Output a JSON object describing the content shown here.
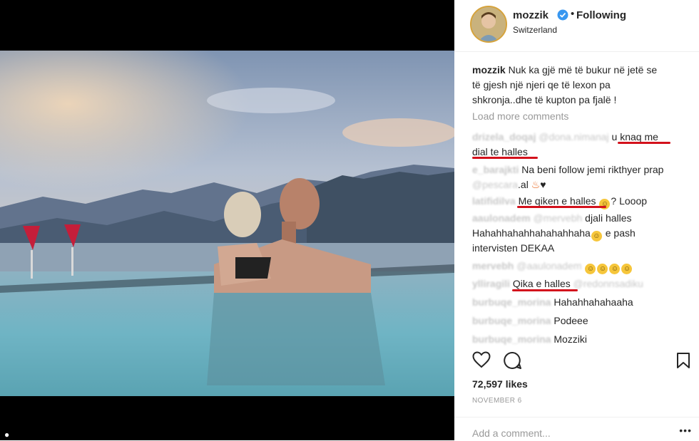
{
  "post": {
    "username": "mozzik",
    "separator": "•",
    "follow_state": "Following",
    "location": "Switzerland",
    "caption_user": "mozzik",
    "caption_lines": [
      "Nuk ka gjë më të bukur në jetë se",
      "të gjesh një njeri qe të lexon pa",
      "shkronja..dhe të kupton pa fjalë !"
    ],
    "load_more": "Load more comments",
    "likes": "72,597 likes",
    "date": "NOVEMBER 6",
    "add_comment_placeholder": "Add a comment...",
    "more_options": "•••"
  },
  "comments": [
    {
      "user": "drizela_doqaj",
      "mention": "@dona.nimanaj",
      "text1": "u knaq me",
      "text2": "dial te halles"
    },
    {
      "user": "e_barajkti",
      "text1": "Na beni follow jemi rikthyer prap",
      "mention": "@pescara",
      "text2": ".al"
    },
    {
      "user": "latifidilva",
      "text": "Me qiken e halles",
      "suffix": "? Looop"
    },
    {
      "user": "aaulonadem",
      "mention": "@mervebh",
      "text1": "djali halles",
      "text2": "Hahahhahahhahahahhaha",
      "text3": " e pash",
      "text4": "intervisten DEKAA"
    },
    {
      "user": "mervebh",
      "mention": "@aaulonadem"
    },
    {
      "user": "ylliragili",
      "text": "Qika e halles",
      "mention": "@redonnsadiku"
    },
    {
      "user": "burbuqe_morina",
      "text": "Hahahhahahaaha"
    },
    {
      "user": "burbuqe_morina",
      "text": "Podeee"
    },
    {
      "user": "burbuqe_morina",
      "text": "Mozziki"
    }
  ],
  "colors": {
    "underline": "#d3111c",
    "verified": "#3897f0",
    "muted": "#999999",
    "ring": "#d6a33c"
  },
  "icons": [
    "heart-icon",
    "comment-icon",
    "bookmark-icon",
    "verified-badge-icon"
  ]
}
